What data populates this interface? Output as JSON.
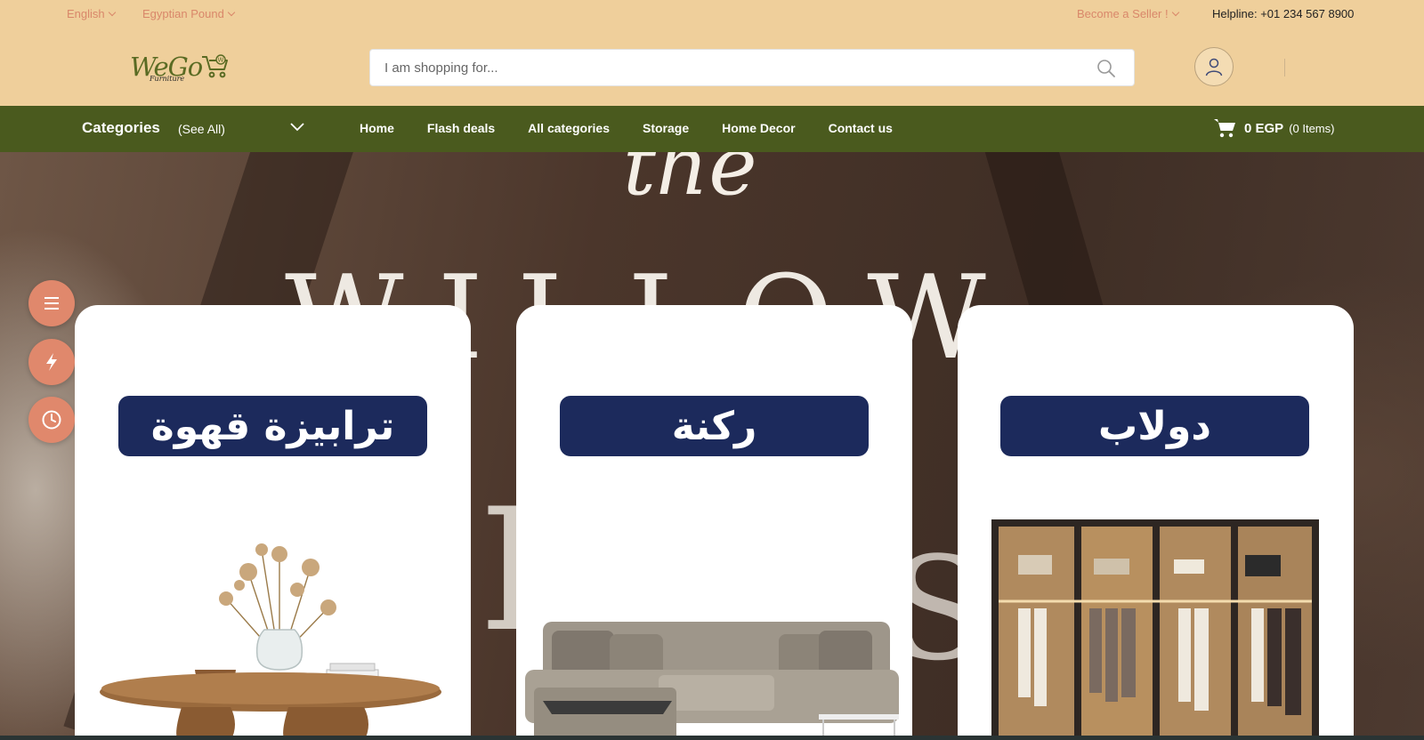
{
  "topbar": {
    "language": "English",
    "currency": "Egyptian Pound",
    "seller": "Become a Seller !",
    "helpline": "Helpline: +01 234 567 8900"
  },
  "header": {
    "logo_text": "WeGo",
    "logo_sub": "Furniture",
    "search_placeholder": "I am shopping for..."
  },
  "nav": {
    "categories_label": "Categories",
    "see_all": "(See All)",
    "links": [
      "Home",
      "Flash deals",
      "All categories",
      "Storage",
      "Home Decor",
      "Contact us"
    ],
    "cart_total": "0 EGP",
    "cart_items": "(0 Items)"
  },
  "hero": {
    "line1": "the",
    "line2": "WILLOW",
    "line3": "H",
    "line4": "S"
  },
  "cards": [
    {
      "label": "ترابيزة قهوة",
      "icon": "coffee-table-image"
    },
    {
      "label": "ركنة",
      "icon": "sofa-image"
    },
    {
      "label": "دولاب",
      "icon": "wardrobe-image"
    }
  ],
  "side_buttons": [
    "menu-icon",
    "flash-icon",
    "clock-icon"
  ],
  "colors": {
    "header_bg": "#efcf9b",
    "nav_bg": "#4a5a1e",
    "accent": "#e0886c",
    "pill_bg": "#1c2a5c"
  }
}
